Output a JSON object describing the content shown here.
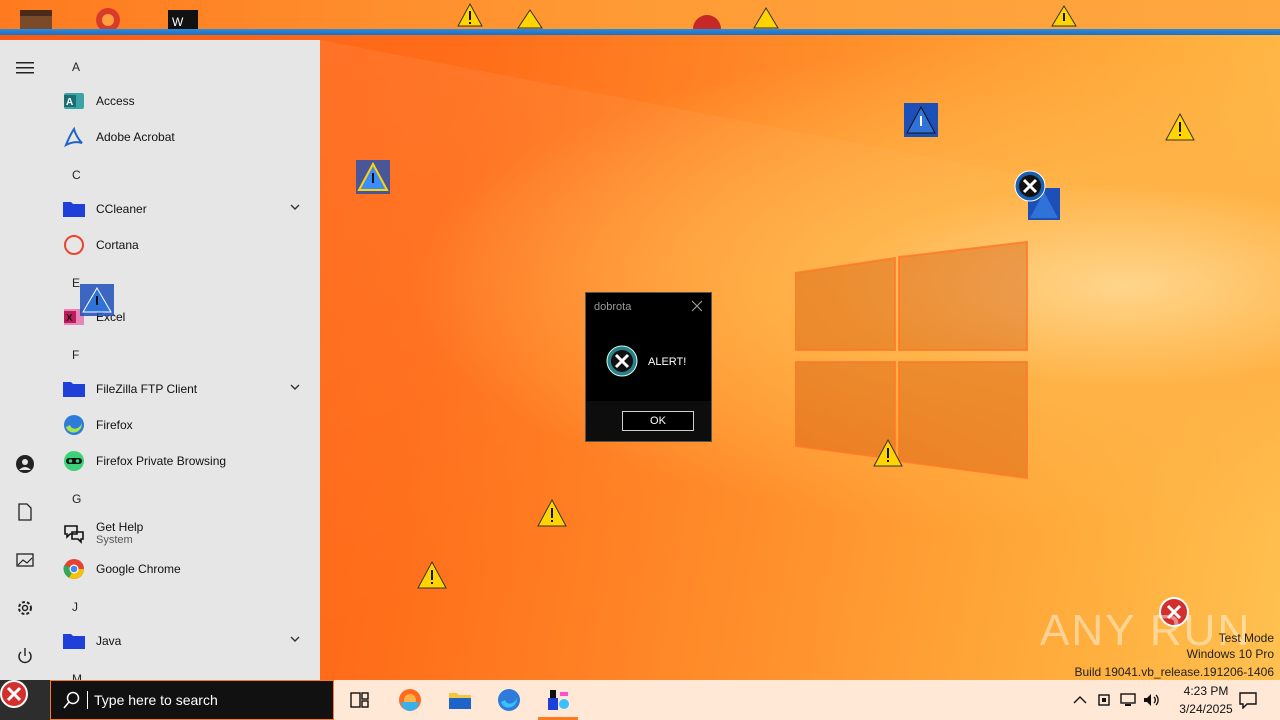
{
  "start_menu": {
    "sections": [
      {
        "letter": "A",
        "apps": [
          {
            "label": "Access",
            "icon": "access-icon"
          },
          {
            "label": "Adobe Acrobat",
            "icon": "acrobat-icon"
          }
        ]
      },
      {
        "letter": "C",
        "apps": [
          {
            "label": "CCleaner",
            "icon": "folder-icon",
            "expand": true
          },
          {
            "label": "Cortana",
            "icon": "cortana-icon"
          }
        ]
      },
      {
        "letter": "E",
        "apps": [
          {
            "label": "Excel",
            "icon": "excel-icon"
          }
        ]
      },
      {
        "letter": "F",
        "apps": [
          {
            "label": "FileZilla FTP Client",
            "icon": "folder-icon",
            "expand": true
          },
          {
            "label": "Firefox",
            "icon": "firefox-icon"
          },
          {
            "label": "Firefox Private Browsing",
            "icon": "firefox-private-icon"
          }
        ]
      },
      {
        "letter": "G",
        "apps": [
          {
            "label": "Get Help",
            "sub": "System",
            "icon": "get-help-icon"
          },
          {
            "label": "Google Chrome",
            "icon": "chrome-icon"
          }
        ]
      },
      {
        "letter": "J",
        "apps": [
          {
            "label": "Java",
            "icon": "folder-icon",
            "expand": true
          }
        ]
      },
      {
        "letter": "M",
        "apps": []
      }
    ]
  },
  "dialog": {
    "title": "dobrota",
    "message": "ALERT!",
    "ok_label": "OK"
  },
  "taskbar": {
    "search_placeholder": "Type here to search",
    "time": "4:23 PM",
    "date": "3/24/2025"
  },
  "desktop": {
    "watermark": "ANY RUN",
    "test_mode": "Test Mode",
    "edition": "Windows 10 Pro",
    "build": "Build 19041.vb_release.191206-1406"
  },
  "colors": {
    "accent": "#ff7a1f",
    "warning": "#ffd400",
    "error": "#d32f2f"
  }
}
